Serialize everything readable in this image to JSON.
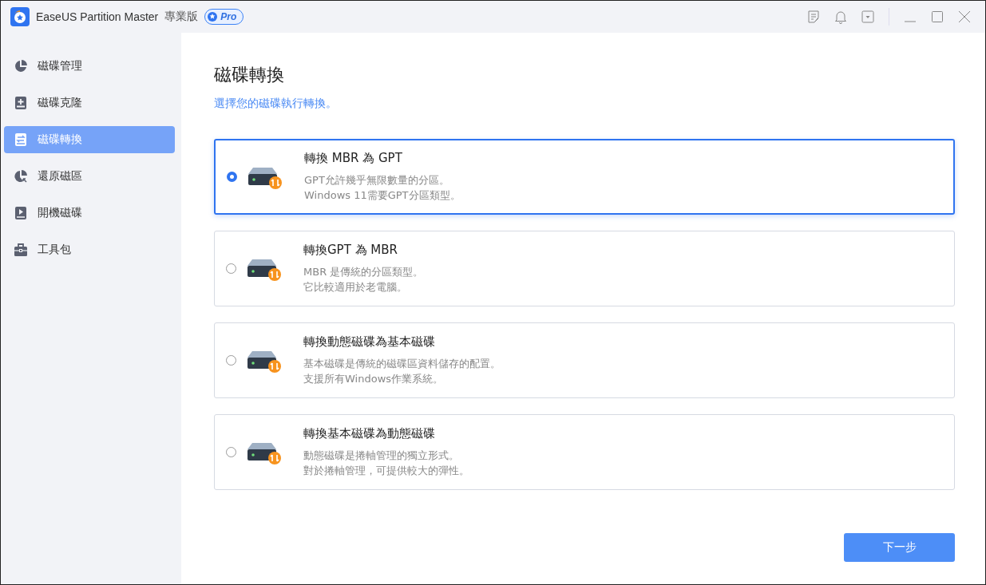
{
  "window": {
    "title": "EaseUS Partition Master",
    "edition": "專業版",
    "badge": "Pro"
  },
  "sidebar": {
    "items": [
      {
        "label": "磁碟管理",
        "selected": false
      },
      {
        "label": "磁碟克隆",
        "selected": false
      },
      {
        "label": "磁碟轉換",
        "selected": true
      },
      {
        "label": "還原磁區",
        "selected": false
      },
      {
        "label": "開機磁碟",
        "selected": false
      },
      {
        "label": "工具包",
        "selected": false
      }
    ]
  },
  "main": {
    "title": "磁碟轉換",
    "subtitle": "選擇您的磁碟執行轉換。",
    "options": [
      {
        "title": "轉換 MBR 為 GPT",
        "lines": [
          "GPT允許幾乎無限數量的分區。",
          "Windows 11需要GPT分區類型。"
        ],
        "selected": true
      },
      {
        "title": "轉換GPT 為 MBR",
        "lines": [
          "MBR 是傳統的分區類型。",
          "它比較適用於老電腦。"
        ],
        "selected": false
      },
      {
        "title": "轉換動態磁碟為基本磁碟",
        "lines": [
          "基本磁碟是傳統的磁碟區資料儲存的配置。",
          "支援所有Windows作業系統。"
        ],
        "selected": false
      },
      {
        "title": "轉換基本磁碟為動態磁碟",
        "lines": [
          "動態磁碟是捲軸管理的獨立形式。",
          "對於捲軸管理，可提供較大的彈性。"
        ],
        "selected": false
      }
    ],
    "next_button": "下一步"
  }
}
